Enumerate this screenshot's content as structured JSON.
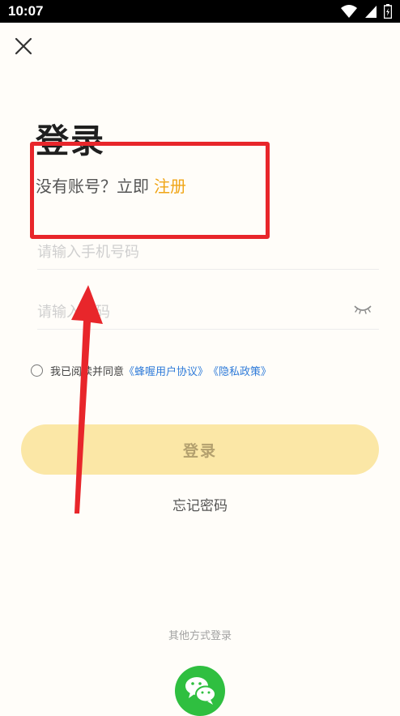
{
  "status_bar": {
    "time": "10:07"
  },
  "header": {
    "title": "登录"
  },
  "register": {
    "prompt": "没有账号？立即",
    "link_label": "注册"
  },
  "form": {
    "phone_placeholder": "请输入手机号码",
    "password_placeholder": "请输入密码"
  },
  "agreement": {
    "prefix": "我已阅读并同意",
    "user_agreement": "《蜂喔用户协议》",
    "privacy_policy": "《隐私政策》"
  },
  "actions": {
    "login_label": "登录",
    "forgot_label": "忘记密码",
    "other_methods_label": "其他方式登录"
  },
  "colors": {
    "accent": "#f0a516",
    "link": "#2f7bd9",
    "login_button": "#fbe7a6",
    "wechat": "#2fbf40",
    "annotation": "#e8262b"
  },
  "icons": {
    "close": "close-icon",
    "eye": "eye-closed-icon",
    "wechat": "wechat-icon",
    "wifi": "wifi-icon",
    "signal": "signal-icon",
    "battery": "battery-icon"
  }
}
